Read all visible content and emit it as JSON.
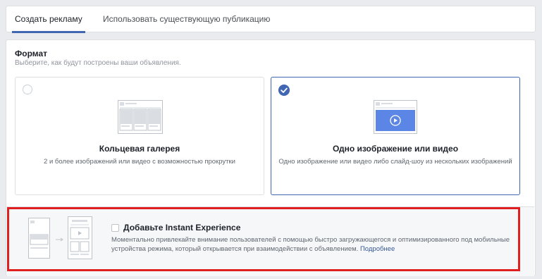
{
  "tabs": {
    "create": "Создать рекламу",
    "existing": "Использовать существующую публикацию"
  },
  "format": {
    "title": "Формат",
    "subtitle": "Выберите, как будут построены ваши объявления."
  },
  "options": [
    {
      "title": "Кольцевая галерея",
      "description": "2 и более изображений или видео с возможностью прокрутки",
      "selected": false,
      "icon": "carousel-preview-icon"
    },
    {
      "title": "Одно изображение или видео",
      "description": "Одно изображение или видео либо слайд-шоу из нескольких изображений",
      "selected": true,
      "icon": "single-image-preview-icon"
    }
  ],
  "instant_experience": {
    "title": "Добавьте Instant Experience",
    "description": "Моментально привлекайте внимание пользователей с помощью быстро загружающегося и оптимизированного под мобильные устройства режима, который открывается при взаимодействии с объявлением.",
    "link": "Подробнее",
    "checked": false
  },
  "colors": {
    "accent": "#4267b2",
    "highlight_border": "#e02020"
  }
}
